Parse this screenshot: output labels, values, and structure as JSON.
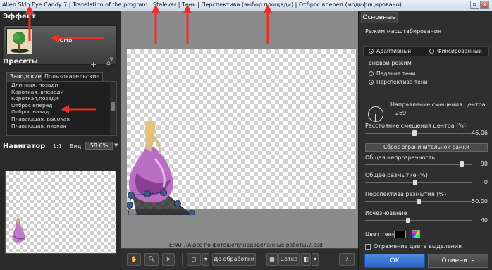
{
  "window": {
    "title": "Alien Skin Eye Candy 7 | Translation of the program : Stalevar | Тень | Перспектива (выбор площади) | Отброс вперед (модифицировано)",
    "buttons": {
      "restore": "⧉",
      "close": "✕"
    }
  },
  "left_panel": {
    "effect_header": "Эффект",
    "effect_name": "Тень",
    "presets_header": "Пресеты",
    "preset_tabs": [
      "Заводские",
      "Пользовательские"
    ],
    "preset_items": [
      "Длинная, позади",
      "Короткая, впереди",
      "Короткая,позади",
      "Отброс вперед",
      "Отброс назад",
      "Плавающая, высокая",
      "Плавающая, низкая"
    ],
    "navigator_header": "Навигатор",
    "nav_ratio": "1:1",
    "nav_view": "Вид",
    "zoom_value": "58.6%"
  },
  "canvas": {
    "file_path": "E:\\АЛЛА\\все по фотошопу\\недоделанные работы\\2.psd"
  },
  "bottom_toolbar": {
    "apply_button": "До обработки",
    "grid_button": "Сетка",
    "icons": [
      "hand-icon",
      "zoom-icon",
      "pointer-icon",
      "swatch-icon",
      "grid-icon",
      "help-icon"
    ]
  },
  "right_panel": {
    "tab": "Основные",
    "scale_mode_label": "Режим масштабирования",
    "scale_options": [
      {
        "label": "Адаптивный",
        "selected": true
      },
      {
        "label": "Фиксированный",
        "selected": false
      }
    ],
    "shadow_mode_label": "Теневой режим",
    "shadow_options": [
      {
        "label": "Падение тени",
        "selected": false
      },
      {
        "label": "Перспектива тени",
        "selected": true
      }
    ],
    "direction_label": "Направление смещения центра",
    "direction_value": "269",
    "distance_label": "Расстояние смещения центра (%)",
    "distance_value": "46.06",
    "bounds_button": "Сброс ограничительной рамки",
    "opacity_label": "Общая непрозрачность",
    "opacity_value": "90",
    "blur_label": "Общее размытие (%)",
    "blur_value": "0",
    "persp_blur_label": "Перспектива размытия (%)",
    "persp_blur_value": "50.00",
    "fade_label": "Исчезновение",
    "fade_value": "40",
    "shadow_color_label": "Цвет тени",
    "shadow_color": "#000000",
    "reflect_label": "Отражение цвета выделения",
    "ok_button": "OK",
    "cancel_button": "Отменить"
  },
  "colors": {
    "accent": "#2f6fd6",
    "annotation": "#e8312a"
  }
}
